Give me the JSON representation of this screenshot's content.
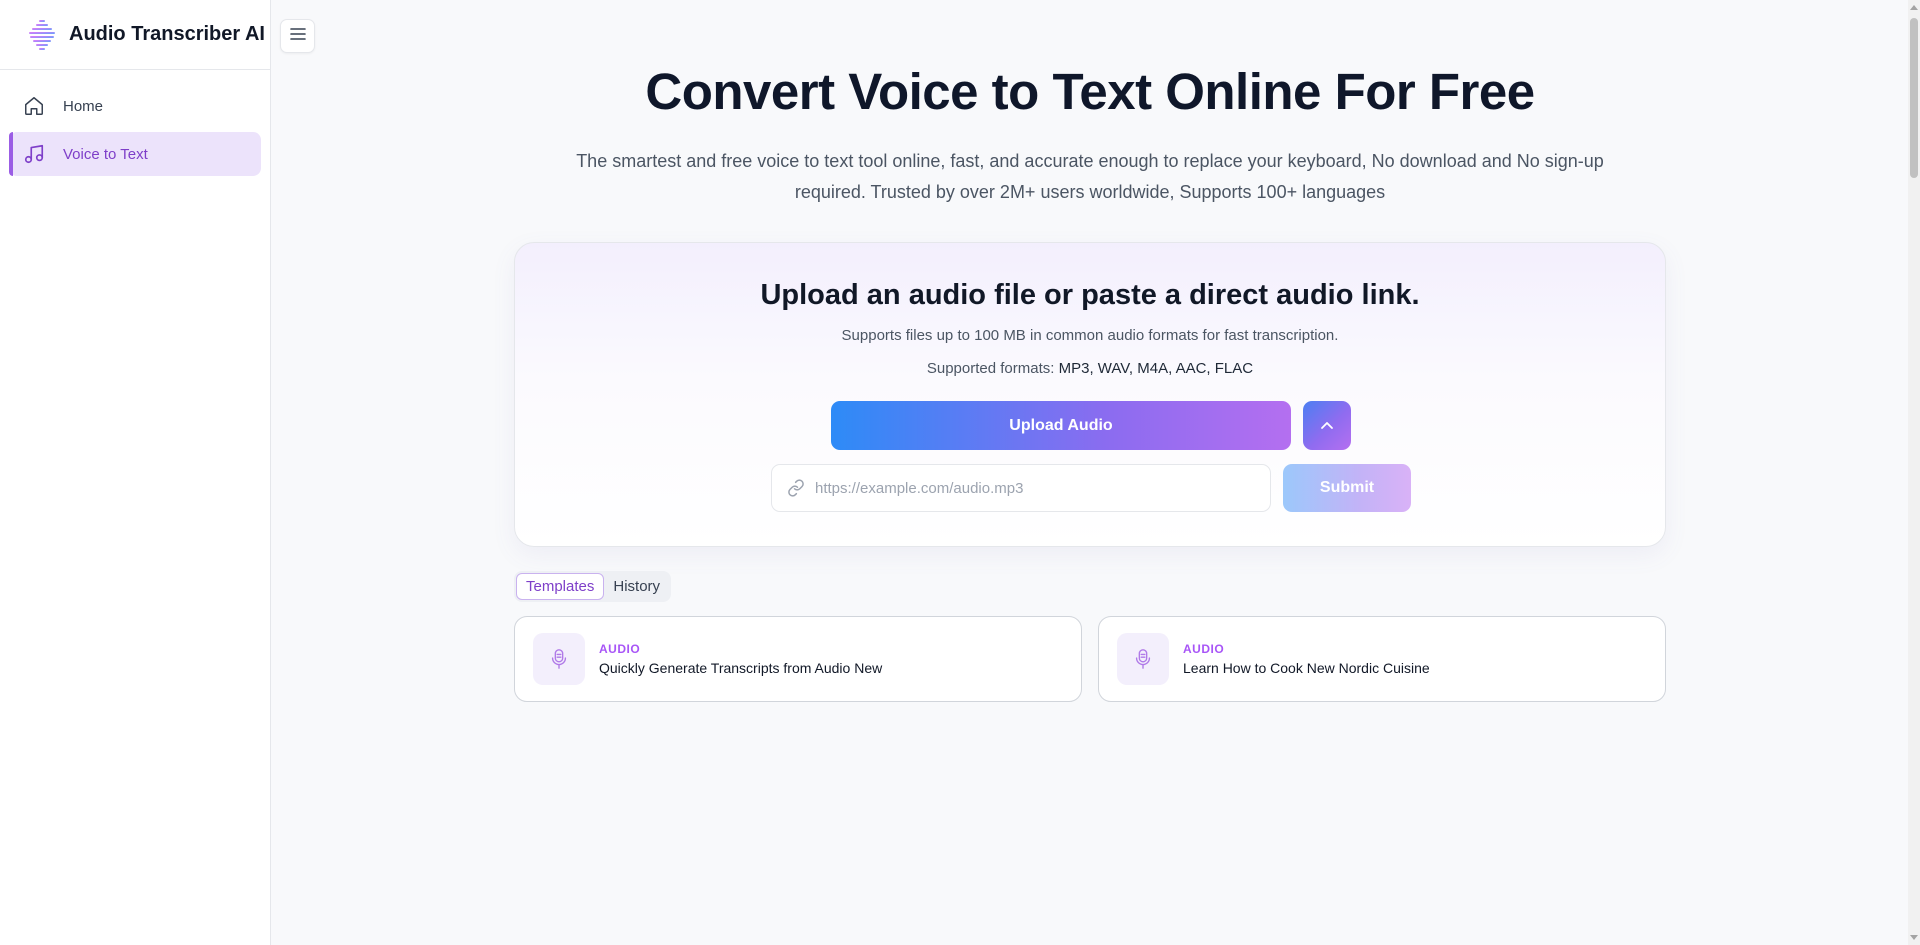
{
  "brand": {
    "name": "Audio Transcriber AI",
    "logo_icon": "waveform-logo-icon"
  },
  "sidebar": {
    "items": [
      {
        "label": "Home",
        "icon": "home-icon",
        "active": false
      },
      {
        "label": "Voice to Text",
        "icon": "music-note-icon",
        "active": true
      }
    ]
  },
  "header": {
    "toggle_icon": "hamburger-menu-icon"
  },
  "hero": {
    "title": "Convert Voice to Text Online For Free",
    "subtitle": "The smartest and free voice to text tool online, fast, and accurate enough to replace your keyboard, No download and No sign-up required. Trusted by over 2M+ users worldwide, Supports 100+ languages"
  },
  "upload": {
    "title": "Upload an audio file or paste a direct audio link.",
    "description": "Supports files up to 100 MB in common audio formats for fast transcription.",
    "formats_label": "Supported formats:",
    "formats": "MP3, WAV, M4A, AAC, FLAC",
    "upload_button": "Upload Audio",
    "url_placeholder": "https://example.com/audio.mp3",
    "url_value": "",
    "submit_button": "Submit"
  },
  "tabs": [
    {
      "label": "Templates",
      "active": true
    },
    {
      "label": "History",
      "active": false
    }
  ],
  "templates": [
    {
      "tag": "AUDIO",
      "title": "Quickly Generate Transcripts from Audio New"
    },
    {
      "tag": "AUDIO",
      "title": "Learn How to Cook New Nordic Cuisine"
    }
  ],
  "colors": {
    "accent": "#9b5de5",
    "gradient_start": "#2d8bf7",
    "gradient_end": "#b46ff0",
    "active_nav_bg": "#ece3fb"
  }
}
